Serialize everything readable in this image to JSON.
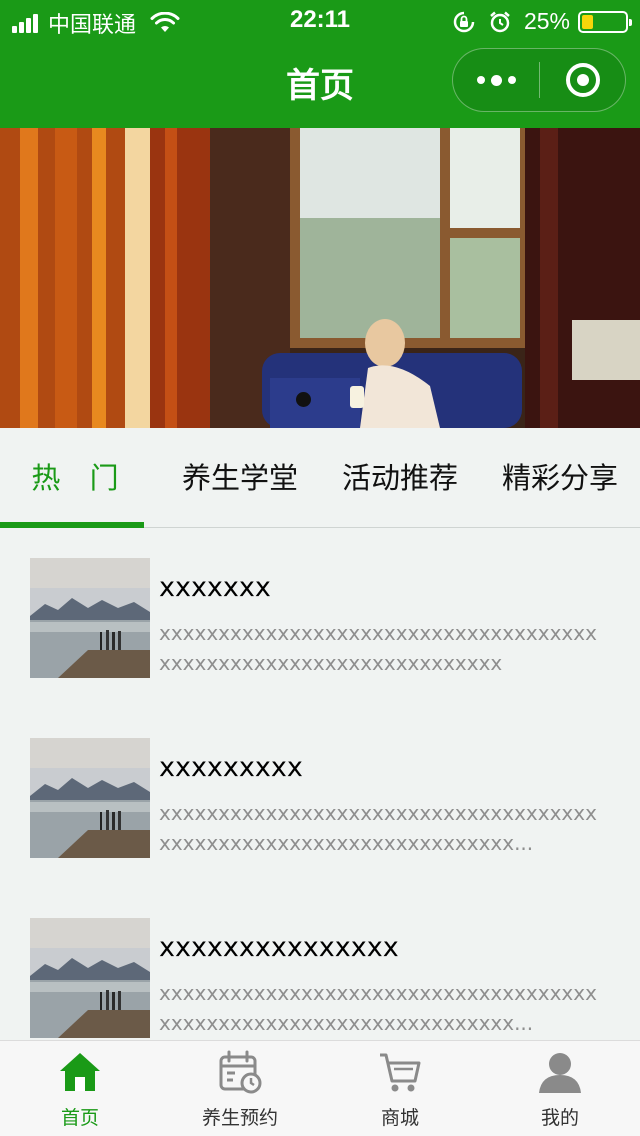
{
  "status_bar": {
    "carrier": "中国联通",
    "time": "22:11",
    "battery": "25%",
    "battery_level": 0.25
  },
  "nav": {
    "title": "首页"
  },
  "banner": {
    "slide_count": 2,
    "active_index": 0
  },
  "tabs": [
    {
      "label": "热 门",
      "active": true
    },
    {
      "label": "养生学堂",
      "active": false
    },
    {
      "label": "活动推荐",
      "active": false
    },
    {
      "label": "精彩分享",
      "active": false
    }
  ],
  "list": [
    {
      "title": "xxxxxxx",
      "desc": "xxxxxxxxxxxxxxxxxxxxxxxxxxxxxxxxxxxxxxxxxxxxxxxxxxxxxxxxxxxxxxxxxx"
    },
    {
      "title": "xxxxxxxxx",
      "desc": "xxxxxxxxxxxxxxxxxxxxxxxxxxxxxxxxxxxxxxxxxxxxxxxxxxxxxxxxxxxxxxxxxxx..."
    },
    {
      "title": "xxxxxxxxxxxxxxx",
      "desc": "xxxxxxxxxxxxxxxxxxxxxxxxxxxxxxxxxxxxxxxxxxxxxxxxxxxxxxxxxxxxxxxxxxx..."
    }
  ],
  "tab_bar": [
    {
      "label": "首页",
      "icon": "home-icon",
      "active": true
    },
    {
      "label": "养生预约",
      "icon": "calendar-clock-icon",
      "active": false
    },
    {
      "label": "商城",
      "icon": "cart-icon",
      "active": false
    },
    {
      "label": "我的",
      "icon": "user-icon",
      "active": false
    }
  ],
  "colors": {
    "brand": "#1a9a17",
    "text_secondary": "#8e8e8e",
    "background": "#f0f3f2"
  }
}
